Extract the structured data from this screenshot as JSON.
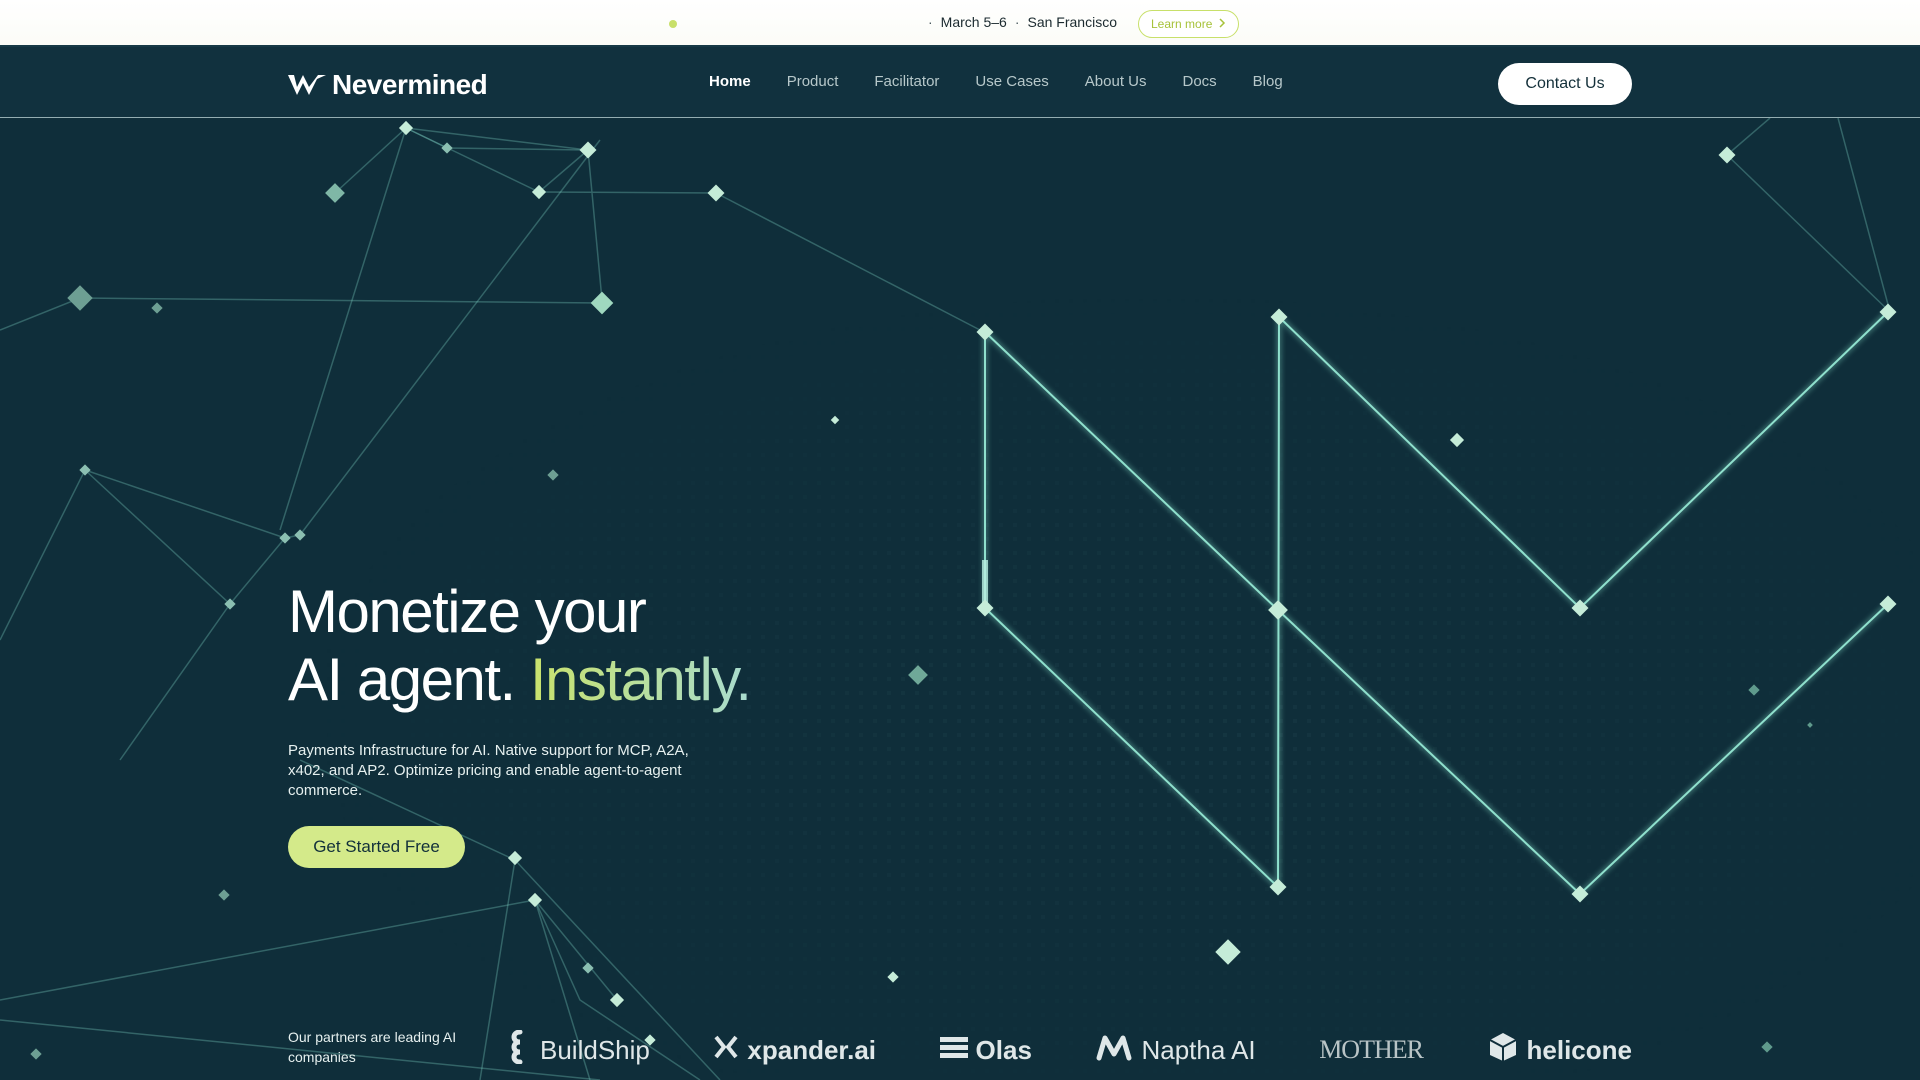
{
  "announcement": {
    "event_prefix": "·",
    "event_dates": "March 5–6",
    "event_sep": "·",
    "event_location": "San Francisco",
    "learn_more": "Learn more",
    "learn_more_icon": "chevron-right-icon",
    "accent_color": "#c8e06a"
  },
  "header": {
    "brand": "Nevermined",
    "nav": [
      "Home",
      "Product",
      "Facilitator",
      "Use Cases",
      "About Us",
      "Docs",
      "Blog"
    ],
    "active_nav": "Home",
    "contact_label": "Contact Us"
  },
  "hero": {
    "title_line1": "Monetize your",
    "title_line2_start": "AI agent.",
    "title_line2_accent": "Instantly.",
    "subtitle": "Payments Infrastructure for AI. Native support for MCP, A2A, x402, and AP2. Optimize pricing and enable agent-to-agent commerce.",
    "cta_label": "Get Started Free",
    "accent_color": "#d4ea8a",
    "background_color": "#0f2e3a"
  },
  "partners": {
    "label": "Our partners are leading AI companies",
    "logos": [
      {
        "name": "BuildShip",
        "icon": "buildship-icon"
      },
      {
        "name": "xpander.ai",
        "icon": "xpander-icon"
      },
      {
        "name": "Olas",
        "icon": "olas-icon"
      },
      {
        "name": "Naptha AI",
        "icon": "naptha-icon"
      },
      {
        "name": "MOTHER",
        "icon": ""
      },
      {
        "name": "helicone",
        "icon": "helicone-icon"
      }
    ]
  }
}
